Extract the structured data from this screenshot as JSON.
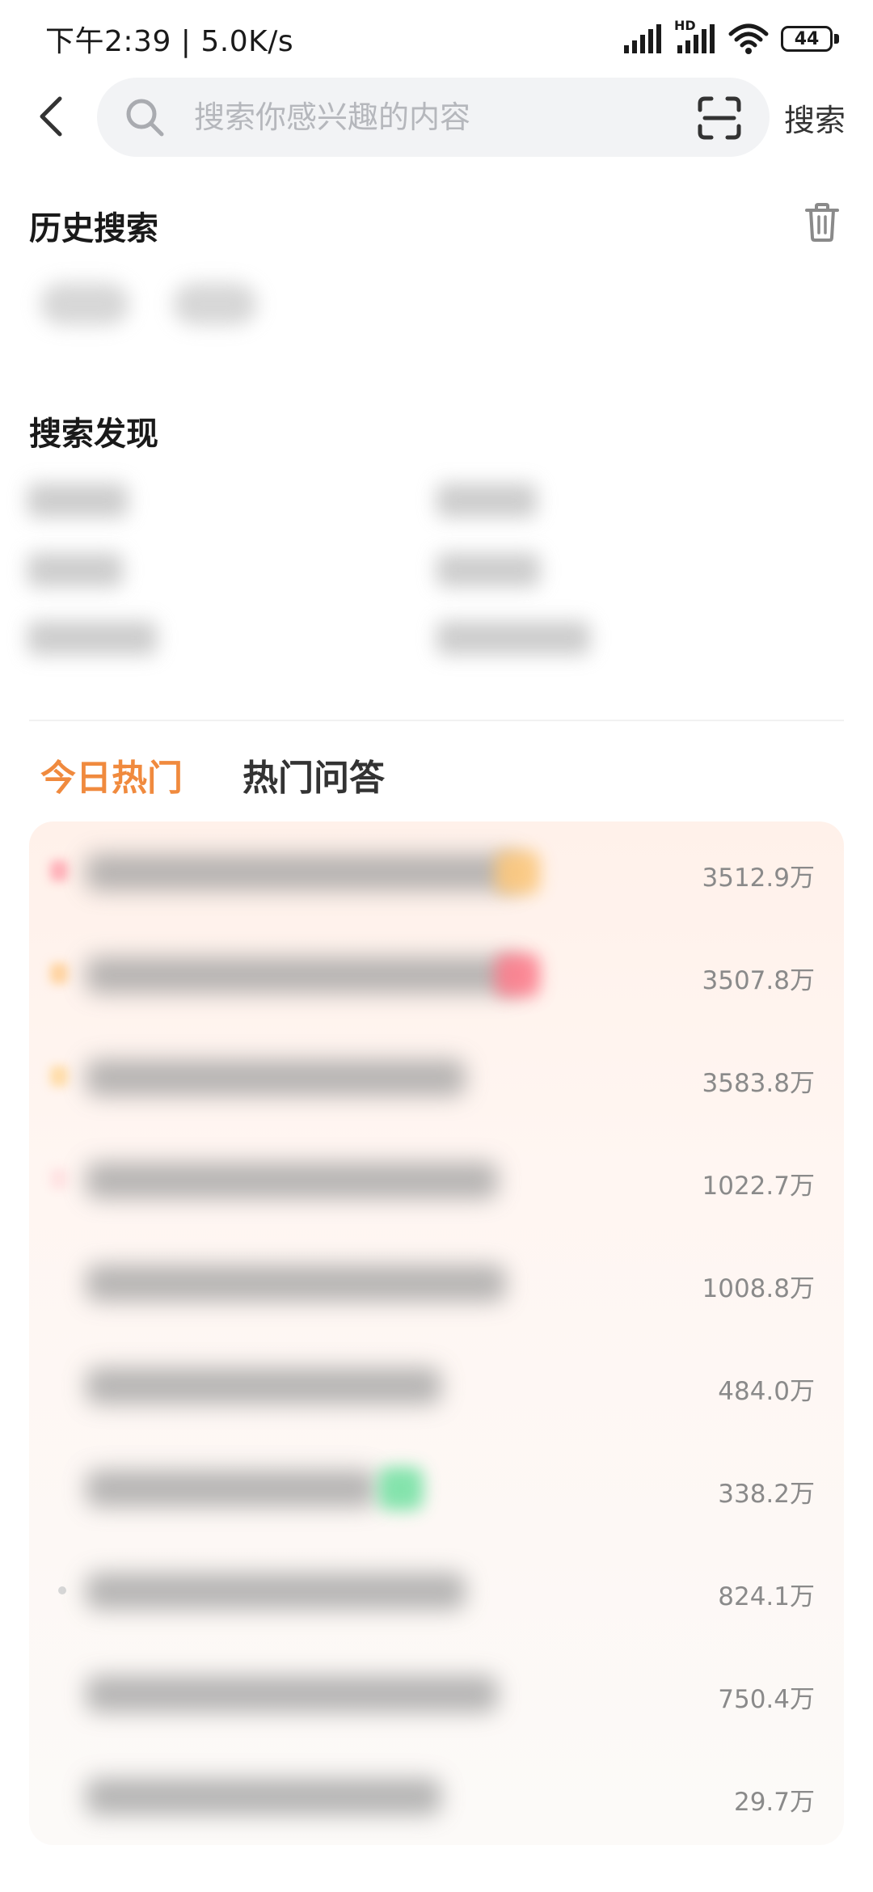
{
  "status_bar": {
    "time": "下午2:39",
    "network_speed": "5.0K/s",
    "battery": "44",
    "hd_label": "HD"
  },
  "header": {
    "search_placeholder": "搜索你感兴趣的内容",
    "search_button": "搜索"
  },
  "history": {
    "title": "历史搜索"
  },
  "discover": {
    "title": "搜索发现"
  },
  "tabs": {
    "today_hot": "今日热门",
    "hot_qa": "热门问答"
  },
  "hot_list": [
    {
      "count": "3512.9万"
    },
    {
      "count": "3507.8万"
    },
    {
      "count": "3583.8万"
    },
    {
      "count": "1022.7万"
    },
    {
      "count": "1008.8万"
    },
    {
      "count": "484.0万"
    },
    {
      "count": "338.2万"
    },
    {
      "count": "824.1万"
    },
    {
      "count": "750.4万"
    },
    {
      "count": "29.7万"
    }
  ],
  "colors": {
    "accent_orange": "#f08a3e",
    "badge_orange": "#ffc879",
    "badge_red": "#ff7a8a",
    "badge_green": "#6fe0a0"
  }
}
